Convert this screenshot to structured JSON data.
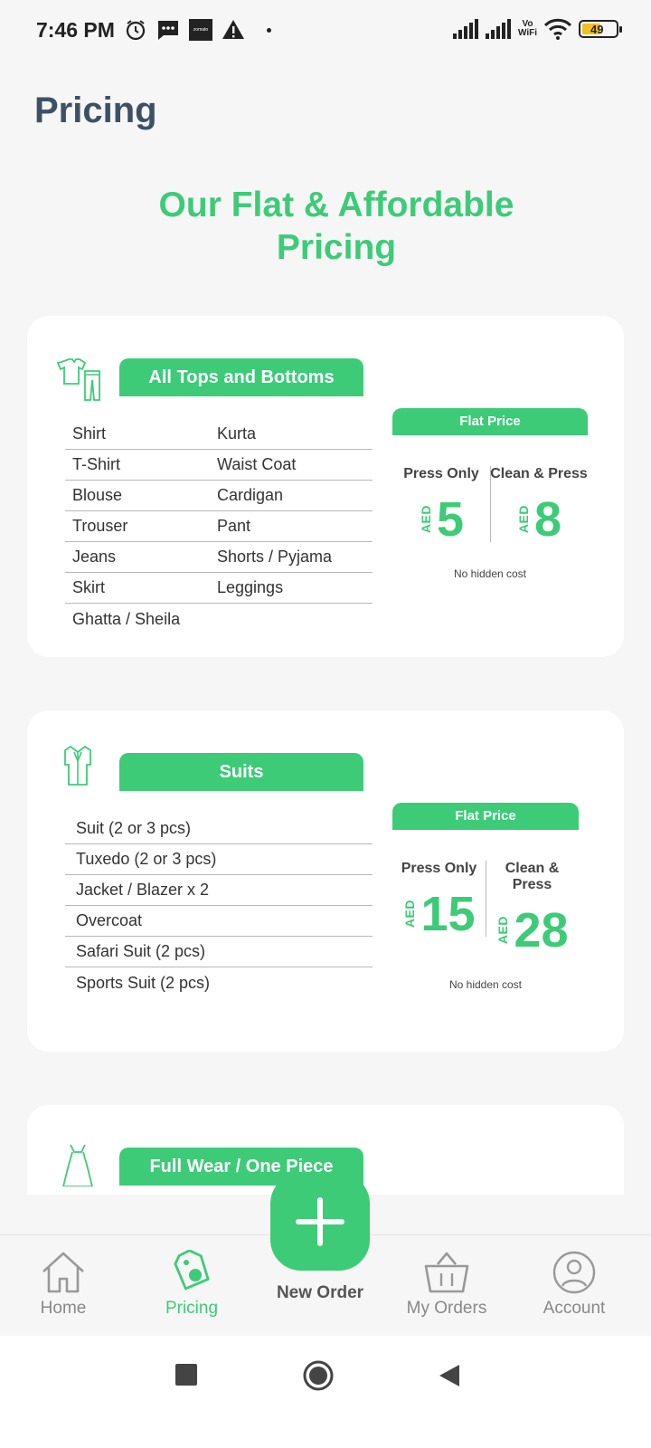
{
  "status_bar": {
    "time": "7:46 PM",
    "zomato": "zomato",
    "vowifi_top": "Vo",
    "vowifi_bottom": "WiFi",
    "battery": "49"
  },
  "page_title": "Pricing",
  "hero": {
    "line1": "Our Flat & Affordable",
    "line2": "Pricing"
  },
  "categories": [
    {
      "name": "All Tops and Bottoms",
      "items": [
        [
          "Shirt",
          "Kurta"
        ],
        [
          "T-Shirt",
          "Waist Coat"
        ],
        [
          "Blouse",
          "Cardigan"
        ],
        [
          "Trouser",
          "Pant"
        ],
        [
          "Jeans",
          "Shorts / Pyjama"
        ],
        [
          "Skirt",
          "Leggings"
        ],
        [
          "Ghatta / Sheila",
          ""
        ]
      ],
      "flat_price_label": "Flat Price",
      "press_only_label": "Press Only",
      "clean_press_label": "Clean & Press",
      "currency": "AED",
      "press_only_price": "5",
      "clean_press_price": "8",
      "note": "No hidden cost"
    },
    {
      "name": "Suits",
      "items": [
        "Suit (2 or 3 pcs)",
        "Tuxedo (2 or 3 pcs)",
        "Jacket / Blazer x 2",
        "Overcoat",
        "Safari Suit (2 pcs)",
        "Sports Suit (2 pcs)"
      ],
      "flat_price_label": "Flat Price",
      "press_only_label": "Press Only",
      "clean_press_label": "Clean & Press",
      "currency": "AED",
      "press_only_price": "15",
      "clean_press_price": "28",
      "note": "No hidden cost"
    },
    {
      "name": "Full Wear / One Piece"
    }
  ],
  "fab": {
    "label": "New Order"
  },
  "bottom_nav": [
    {
      "label": "Home",
      "icon": "home-icon"
    },
    {
      "label": "Pricing",
      "icon": "price-tag-icon",
      "active": true
    },
    {
      "label": "My Orders",
      "icon": "basket-icon"
    },
    {
      "label": "Account",
      "icon": "user-icon"
    }
  ],
  "colors": {
    "accent": "#3dcb78",
    "title": "#3d5166",
    "background": "#f6f6f6"
  }
}
